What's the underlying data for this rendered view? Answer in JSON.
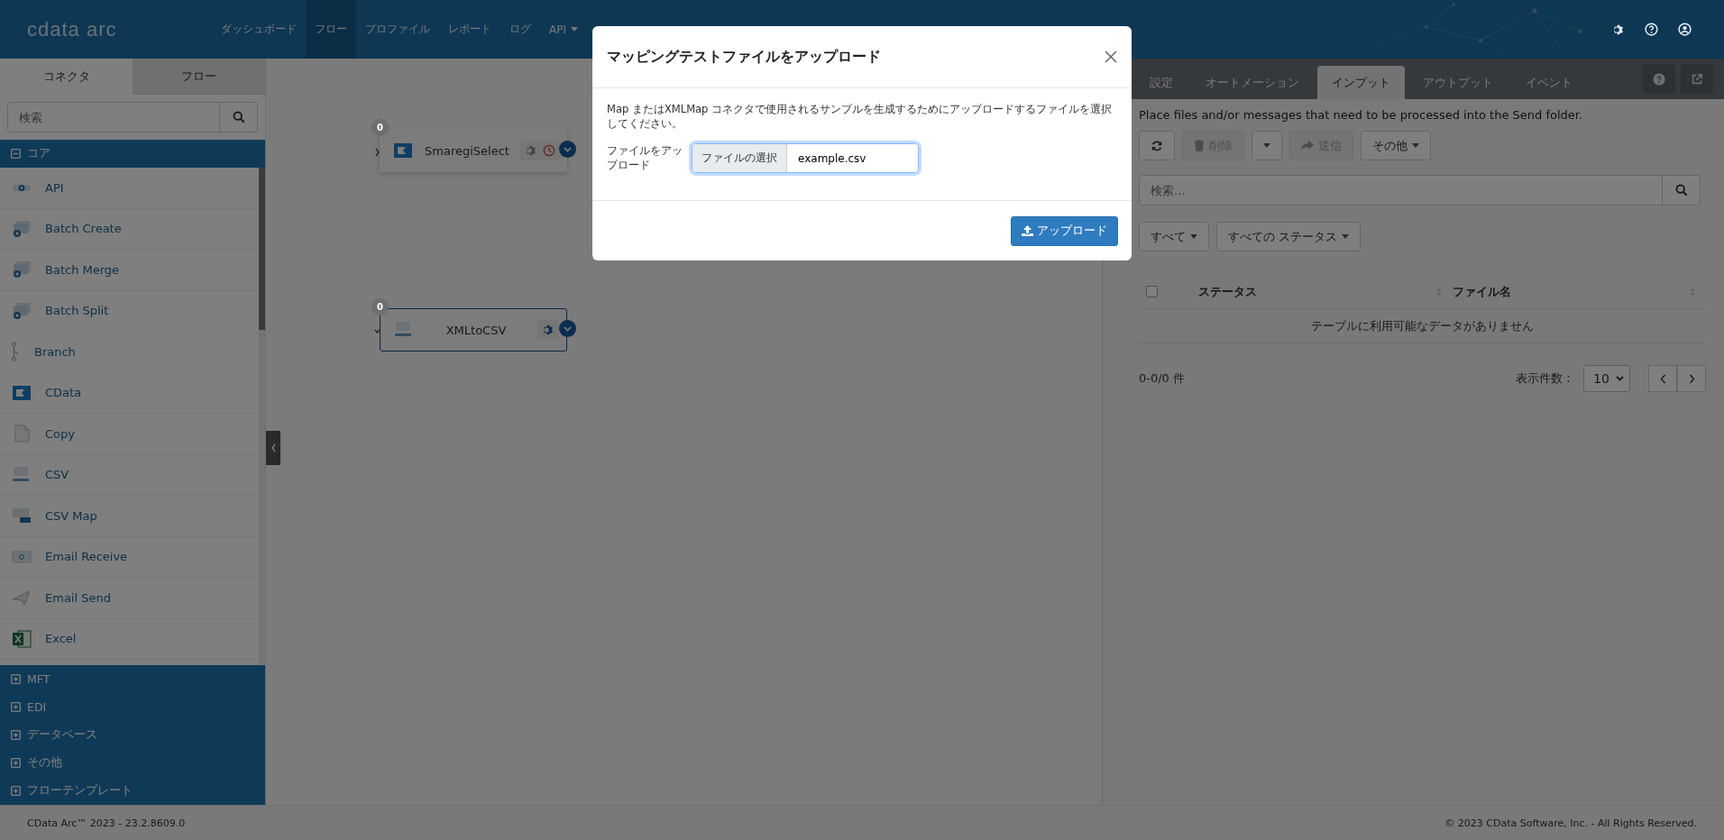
{
  "header": {
    "logo": "cdata arc",
    "nav": [
      {
        "label": "ダッシュボード",
        "selected": false,
        "dropdown": false
      },
      {
        "label": "フロー",
        "selected": true,
        "dropdown": false
      },
      {
        "label": "プロファイル",
        "selected": false,
        "dropdown": false
      },
      {
        "label": "レポート",
        "selected": false,
        "dropdown": false
      },
      {
        "label": "ログ",
        "selected": false,
        "dropdown": false
      },
      {
        "label": "API",
        "selected": false,
        "dropdown": true
      }
    ]
  },
  "sidebar": {
    "tabs": [
      {
        "label": "コネクタ",
        "selected": true
      },
      {
        "label": "フロー",
        "selected": false
      }
    ],
    "search": {
      "placeholder": "検索"
    },
    "categories": [
      {
        "label": "コア",
        "expanded": true,
        "items": [
          {
            "label": "API",
            "kind": "gear"
          },
          {
            "label": "Batch Create",
            "kind": "batch"
          },
          {
            "label": "Batch Merge",
            "kind": "batch"
          },
          {
            "label": "Batch Split",
            "kind": "batch"
          },
          {
            "label": "Branch",
            "kind": "branch"
          },
          {
            "label": "CData",
            "kind": "cdata"
          },
          {
            "label": "Copy",
            "kind": "copy"
          },
          {
            "label": "CSV",
            "kind": "csv"
          },
          {
            "label": "CSV Map",
            "kind": "csvmap"
          },
          {
            "label": "Email Receive",
            "kind": "mail"
          },
          {
            "label": "Email Send",
            "kind": "send"
          },
          {
            "label": "Excel",
            "kind": "excel"
          }
        ]
      },
      {
        "label": "MFT",
        "expanded": false
      },
      {
        "label": "EDI",
        "expanded": false
      },
      {
        "label": "データベース",
        "expanded": false
      },
      {
        "label": "その他",
        "expanded": false
      },
      {
        "label": "フローテンプレート",
        "expanded": false
      }
    ]
  },
  "canvas": {
    "nodes": [
      {
        "name": "SmaregiSelect",
        "count": "0",
        "kind": "cdata",
        "selected": false,
        "schedule": true
      },
      {
        "name": "XMLtoCSV",
        "count": "0",
        "kind": "csv",
        "selected": true,
        "schedule": false
      }
    ]
  },
  "panel": {
    "tabs": [
      {
        "label": "設定",
        "selected": false
      },
      {
        "label": "オートメーション",
        "selected": false
      },
      {
        "label": "インプット",
        "selected": true
      },
      {
        "label": "アウトプット",
        "selected": false
      },
      {
        "label": "イベント",
        "selected": false
      }
    ],
    "description": "Place files and/or messages that need to be processed into the  Send folder.",
    "toolbar": {
      "delete": {
        "label": "削除",
        "disabled": true
      },
      "send": {
        "label": "送信",
        "disabled": true
      },
      "more": {
        "label": "その他"
      }
    },
    "search": {
      "placeholder": "検索..."
    },
    "filters": [
      {
        "label": "すべて"
      },
      {
        "label": "すべての ステータス"
      }
    ],
    "table": {
      "select_all": false,
      "columns": [
        "ステータス",
        "ファイル名"
      ],
      "empty_message": "テーブルに利用可能なデータがありません"
    },
    "footer": {
      "count": "0-0/0 件",
      "page_size_label": "表示件数：",
      "page_size": "10"
    }
  },
  "modal": {
    "title": "マッピングテストファイルをアップロード",
    "description": "Map またはXMLMap コネクタで使用されるサンプルを生成するためにアップロードするファイルを選択してください。",
    "field_label": "ファイルをアップロード",
    "choose_button": "ファイルの選択",
    "file_name": "example.csv",
    "submit": "アップロード"
  },
  "status_bar": {
    "version": "CData Arc™ 2023 - 23.2.8609.0",
    "copyright": "© 2023 CData Software, Inc. - All Rights Reserved."
  }
}
